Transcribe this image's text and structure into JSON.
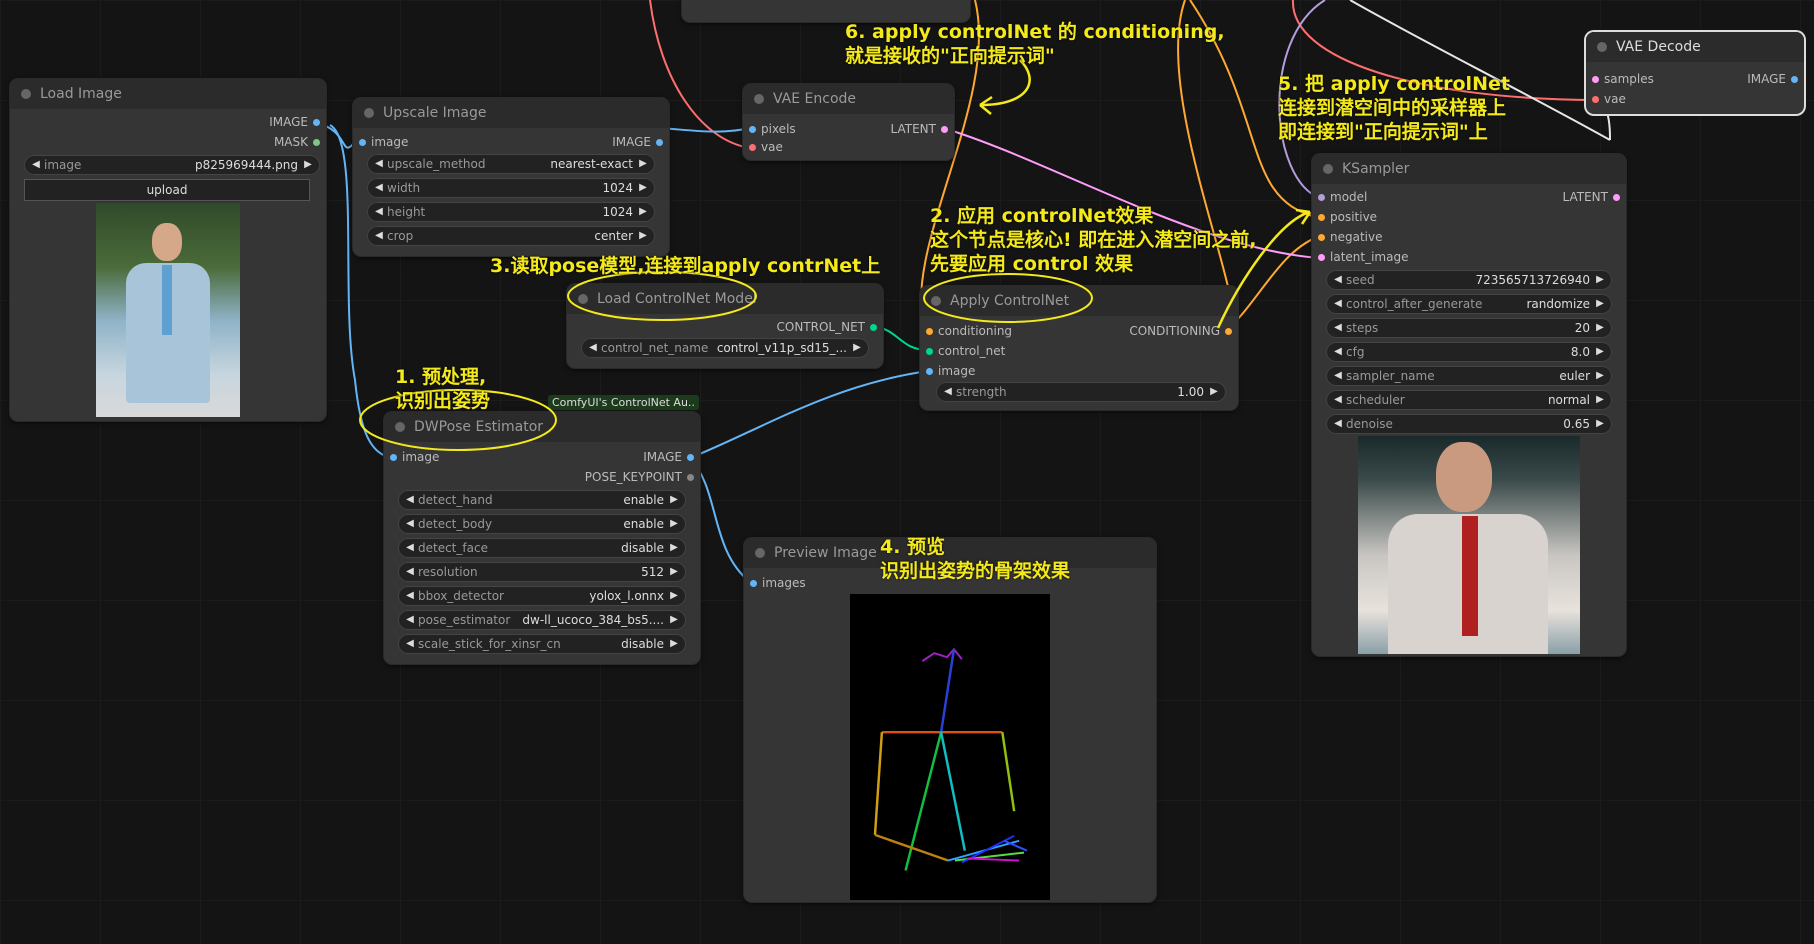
{
  "colors": {
    "image": "#64b5f6",
    "latent": "#ff9cf9",
    "conditioning": "#ffa931",
    "control_net": "#00d78d",
    "model": "#b39ddb",
    "vae": "#ff6e6e",
    "mask": "#81c784",
    "annotation": "#f4e91a"
  },
  "nodes": {
    "load_image": {
      "title": "Load Image",
      "out_image": "IMAGE",
      "out_mask": "MASK",
      "widget_label": "image",
      "widget_value": "p825969444.png",
      "upload": "upload"
    },
    "upscale": {
      "title": "Upscale Image",
      "in_image": "image",
      "out_image": "IMAGE",
      "widgets": [
        {
          "label": "upscale_method",
          "value": "nearest-exact"
        },
        {
          "label": "width",
          "value": "1024"
        },
        {
          "label": "height",
          "value": "1024"
        },
        {
          "label": "crop",
          "value": "center"
        }
      ]
    },
    "vae_encode": {
      "title": "VAE Encode",
      "in_pixels": "pixels",
      "in_vae": "vae",
      "out_latent": "LATENT"
    },
    "load_controlnet": {
      "title": "Load ControlNet Model",
      "out": "CONTROL_NET",
      "widget_label": "control_net_name",
      "widget_value": "control_v11p_sd15_..."
    },
    "apply_controlnet": {
      "title": "Apply ControlNet",
      "in_conditioning": "conditioning",
      "in_control_net": "control_net",
      "in_image": "image",
      "out": "CONDITIONING",
      "strength_label": "strength",
      "strength_value": "1.00"
    },
    "dwpose": {
      "title": "DWPose Estimator",
      "badge": "ComfyUI's ControlNet Au..",
      "in_image": "image",
      "out_image": "IMAGE",
      "out_pose": "POSE_KEYPOINT",
      "widgets": [
        {
          "label": "detect_hand",
          "value": "enable"
        },
        {
          "label": "detect_body",
          "value": "enable"
        },
        {
          "label": "detect_face",
          "value": "disable"
        },
        {
          "label": "resolution",
          "value": "512"
        },
        {
          "label": "bbox_detector",
          "value": "yolox_l.onnx"
        },
        {
          "label": "pose_estimator",
          "value": "dw-ll_ucoco_384_bs5...."
        },
        {
          "label": "scale_stick_for_xinsr_cn",
          "value": "disable"
        }
      ]
    },
    "preview": {
      "title": "Preview Image",
      "in_images": "images"
    },
    "ksampler": {
      "title": "KSampler",
      "in_model": "model",
      "in_positive": "positive",
      "in_negative": "negative",
      "in_latent": "latent_image",
      "out": "LATENT",
      "widgets": [
        {
          "label": "seed",
          "value": "723565713726940"
        },
        {
          "label": "control_after_generate",
          "value": "randomize"
        },
        {
          "label": "steps",
          "value": "20"
        },
        {
          "label": "cfg",
          "value": "8.0"
        },
        {
          "label": "sampler_name",
          "value": "euler"
        },
        {
          "label": "scheduler",
          "value": "normal"
        },
        {
          "label": "denoise",
          "value": "0.65"
        }
      ]
    },
    "vae_decode": {
      "title": "VAE Decode",
      "in_samples": "samples",
      "in_vae": "vae",
      "out": "IMAGE"
    }
  },
  "annotations": {
    "a1_l1": "1. 预处理,",
    "a1_l2": "识别出姿势",
    "a2_l1": "2. 应用 controlNet效果",
    "a2_l2": "这个节点是核心! 即在进入潜空间之前,",
    "a2_l3": "先要应用 control 效果",
    "a3": "3.读取pose模型,连接到apply contrNet上",
    "a4_l1": "4. 预览",
    "a4_l2": "识别出姿势的骨架效果",
    "a5_l1": "5. 把 apply controlNet",
    "a5_l2": "连接到潜空间中的采样器上",
    "a5_l3": "即连接到\"正向提示词\"上",
    "a6_l1": "6. apply controlNet 的 conditioning,",
    "a6_l2": "就是接收的\"正向提示词\""
  }
}
